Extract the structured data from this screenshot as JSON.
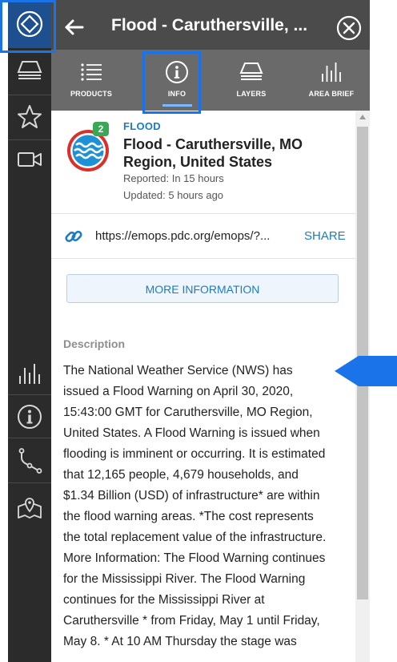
{
  "header": {
    "title": "Flood - Caruthersville, ..."
  },
  "tabs": [
    {
      "label": "PRODUCTS",
      "icon": "list-icon",
      "selected": false
    },
    {
      "label": "INFO",
      "icon": "info-icon",
      "selected": true
    },
    {
      "label": "LAYERS",
      "icon": "layers-icon",
      "selected": false
    },
    {
      "label": "AREA BRIEF",
      "icon": "bar-chart-icon",
      "selected": false
    }
  ],
  "rail": {
    "items": [
      "home-logo-icon",
      "layers-icon",
      "star-icon",
      "video-camera-icon",
      "bar-chart-icon",
      "info-icon",
      "route-icon",
      "map-pin-icon"
    ]
  },
  "hazard": {
    "type": "FLOOD",
    "name": "Flood - Caruthersville, MO Region, United States",
    "reported": "Reported: In 15 hours",
    "updated": "Updated: 5 hours ago",
    "badge_count": "2"
  },
  "link": {
    "url": "https://emops.pdc.org/emops/?...",
    "share_label": "SHARE"
  },
  "more_info_label": "MORE INFORMATION",
  "description": {
    "label": "Description",
    "text": "The National Weather Service (NWS) has issued a Flood Warning on April 30, 2020, 15:43:00 GMT for Caruthersville, MO Region, United States. A Flood Warning is issued when flooding is imminent or occurring. It is estimated that 12,165 people, 4,679 households, and $1.34 Billion (USD) of infrastructure* are within the flood warning areas. *The cost represents the total replacement value of the infrastructure. More Information: The Flood Warning continues for the Mississippi River. The Flood Warning continues for the Mississippi River at Caruthersville * from Friday, May 1 until Friday, May 8. * At 10 AM Thursday the stage was"
  },
  "colors": {
    "rail_bg": "#2b2b2b",
    "header_bg": "#4b4b4b",
    "tabs_bg": "#6a6a6a",
    "accent_blue": "#1a7dc4",
    "highlight_blue": "#1a73e8",
    "badge_green": "#3aa757",
    "hazard_red": "#d9302c"
  }
}
